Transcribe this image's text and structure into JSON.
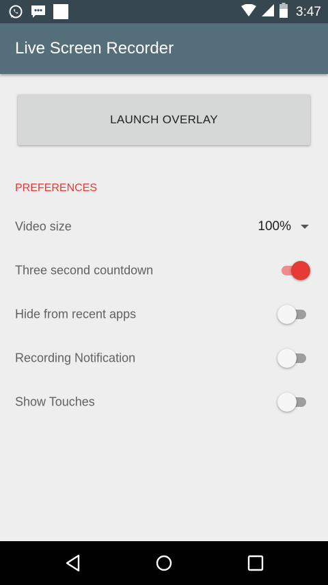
{
  "status_bar": {
    "time": "3:47",
    "icons": [
      "whatsapp-icon",
      "message-icon",
      "square-notification-icon",
      "wifi-icon",
      "signal-icon",
      "battery-icon"
    ],
    "background": "#37474f"
  },
  "app_bar": {
    "title": "Live Screen Recorder",
    "background": "#546e7a"
  },
  "launch_button": {
    "label": "LAUNCH OVERLAY"
  },
  "preferences": {
    "header": "PREFERENCES",
    "accent": "#e53935",
    "video_size": {
      "label": "Video size",
      "value": "100%"
    },
    "items": [
      {
        "label": "Three second countdown",
        "checked": true
      },
      {
        "label": "Hide from recent apps",
        "checked": false
      },
      {
        "label": "Recording Notification",
        "checked": false
      },
      {
        "label": "Show Touches",
        "checked": false
      }
    ]
  },
  "nav_bar": {
    "icons": [
      "back-icon",
      "home-icon",
      "recents-icon"
    ]
  }
}
